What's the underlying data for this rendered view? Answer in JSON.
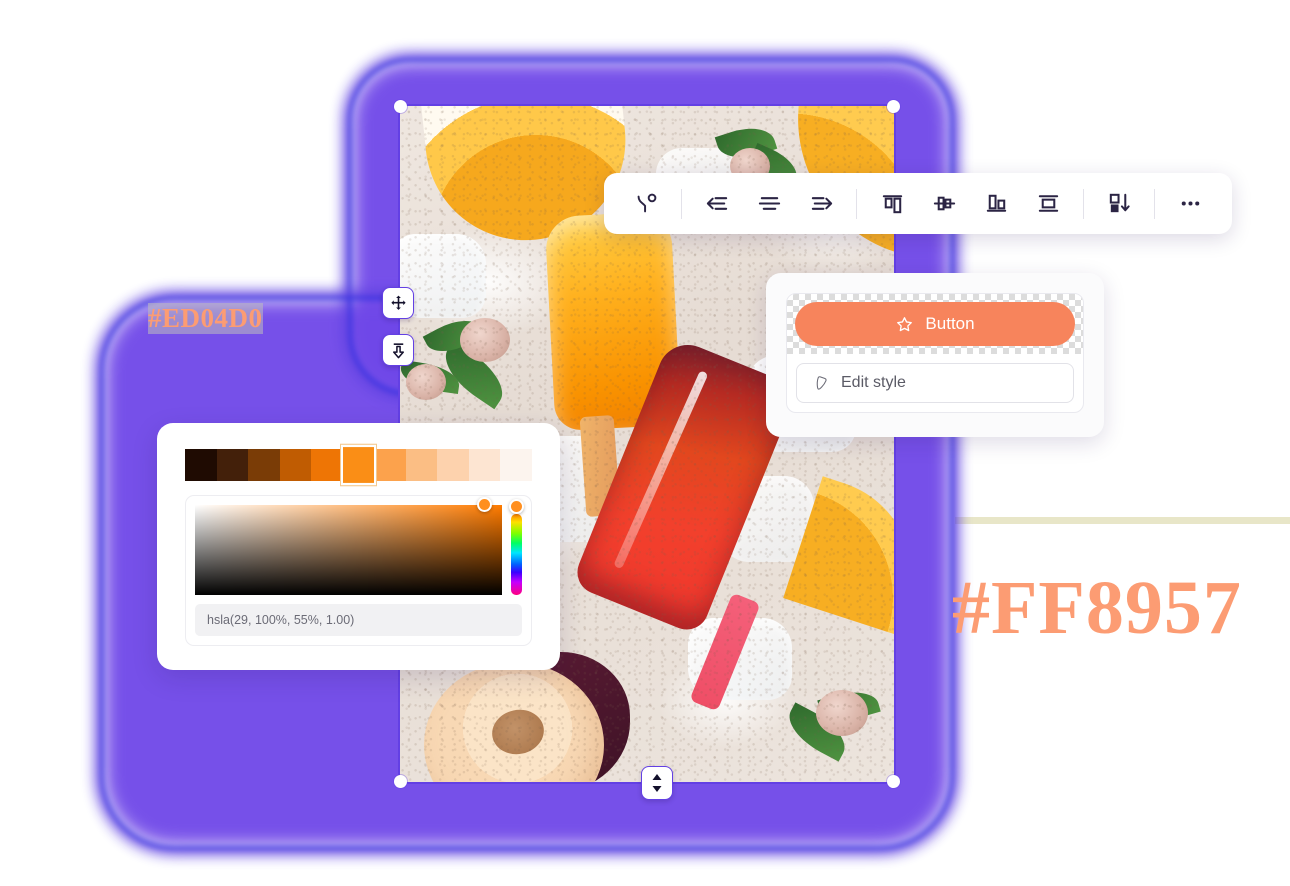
{
  "canvas": {
    "selection_color": "#6340E4",
    "glow_color": "#6F47E8"
  },
  "toolbar": {
    "items": [
      {
        "name": "rotate-angle-icon",
        "label": "Rotate / angle",
        "group": 0
      },
      {
        "name": "align-left-icon",
        "label": "Align left",
        "group": 1
      },
      {
        "name": "align-center-h-icon",
        "label": "Align horizontal center",
        "group": 1
      },
      {
        "name": "align-right-icon",
        "label": "Align right",
        "group": 1
      },
      {
        "name": "align-top-icon",
        "label": "Align top",
        "group": 2
      },
      {
        "name": "align-center-v-icon",
        "label": "Align vertical center",
        "group": 2
      },
      {
        "name": "align-bottom-icon",
        "label": "Align bottom",
        "group": 2
      },
      {
        "name": "distribute-icon",
        "label": "Distribute",
        "group": 2
      },
      {
        "name": "send-backward-icon",
        "label": "Send backward",
        "group": 3
      },
      {
        "name": "more-options-icon",
        "label": "More options",
        "group": 4
      }
    ]
  },
  "style_panel": {
    "button_label": "Button",
    "button_icon": "star-icon",
    "button_fill": "#F7845C",
    "edit_style_label": "Edit style",
    "edit_style_icon": "pen-icon"
  },
  "color_panel": {
    "swatches": [
      "#1F0B02",
      "#43200A",
      "#7A3C06",
      "#C05C02",
      "#EE7505",
      "#FA8E16",
      "#FCA24C",
      "#FBBE84",
      "#FDD2AD",
      "#FDE5D2",
      "#FCF4EE"
    ],
    "selected_swatch_index": 5,
    "hue": 29,
    "saturation": 100,
    "lightness": 55,
    "alpha": 1.0,
    "hsla_value": "hsla(29, 100%, 55%, 1.00)",
    "current_color": "#FF8F1F"
  },
  "handles": {
    "move": "move-handle-icon",
    "align_down": "align-down-handle-icon",
    "resize_vertical": "resize-vertical-handle-icon"
  },
  "hex_labels": {
    "left": "#ED04D0",
    "right": "#FF8957",
    "color": "#FC9C73"
  }
}
